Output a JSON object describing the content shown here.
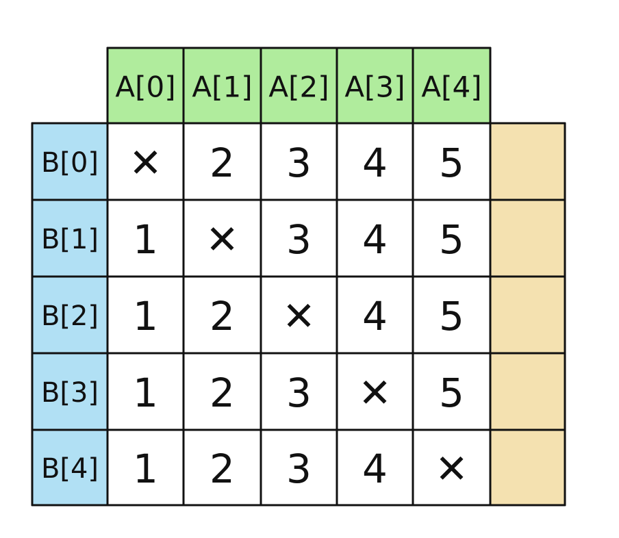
{
  "colors": {
    "header_fill": "#b0ec9d",
    "row_header_fill": "#b1e0f4",
    "extra_column_fill": "#f4e1b0",
    "cell_fill": "#ffffff",
    "grid_line": "#111111",
    "cross_color": "#e0412c"
  },
  "table": {
    "column_headers": [
      "A[0]",
      "A[1]",
      "A[2]",
      "A[3]",
      "A[4]"
    ],
    "row_headers": [
      "B[0]",
      "B[1]",
      "B[2]",
      "B[3]",
      "B[4]"
    ],
    "cross_symbol": "✕",
    "rows": [
      [
        "x",
        "2",
        "3",
        "4",
        "5"
      ],
      [
        "1",
        "x",
        "3",
        "4",
        "5"
      ],
      [
        "1",
        "2",
        "x",
        "4",
        "5"
      ],
      [
        "1",
        "2",
        "3",
        "x",
        "5"
      ],
      [
        "1",
        "2",
        "3",
        "4",
        "x"
      ]
    ],
    "extra_column": {
      "icon": "blank-highlighted-column",
      "values": [
        "",
        "",
        "",
        "",
        ""
      ]
    }
  }
}
